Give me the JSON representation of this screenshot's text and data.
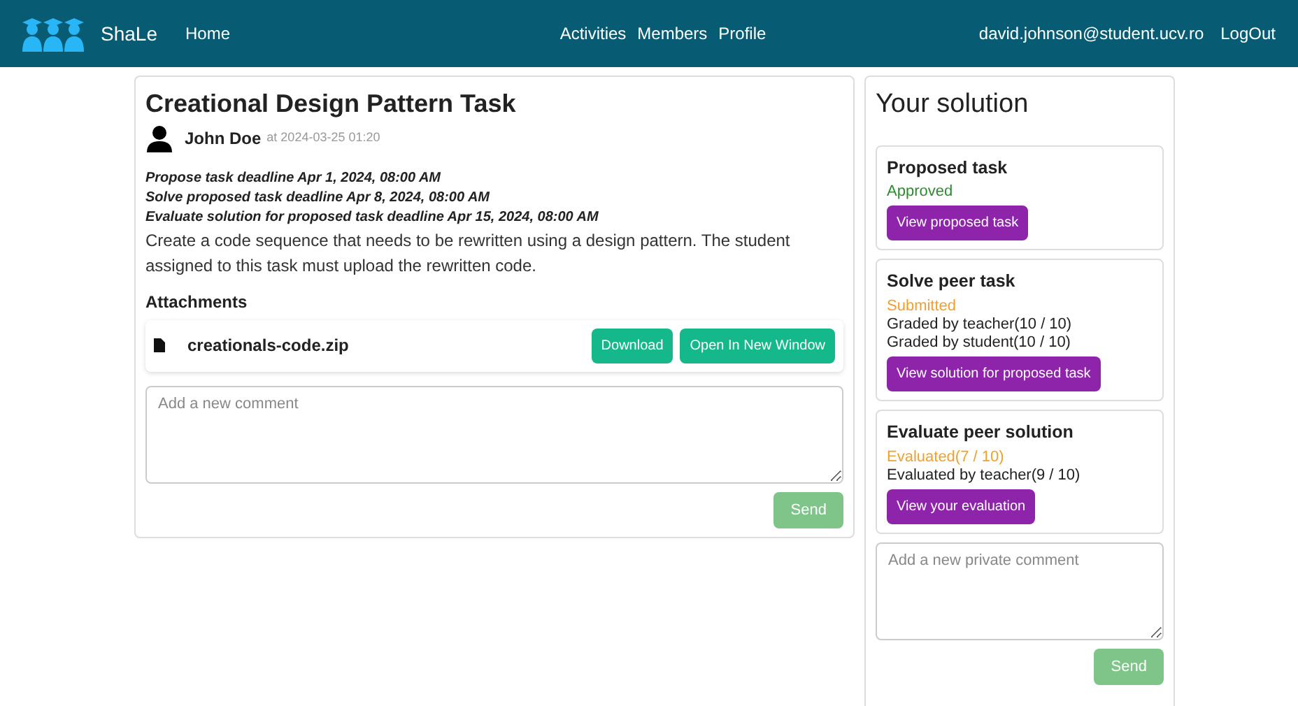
{
  "navbar": {
    "brand": "ShaLe",
    "left_links": [
      "Home"
    ],
    "center_links": [
      "Activities",
      "Members",
      "Profile"
    ],
    "user": "david.johnson@student.ucv.ro",
    "logout": "LogOut"
  },
  "task": {
    "title": "Creational Design Pattern Task",
    "author": "John Doe",
    "posted": "at 2024-03-25 01:20",
    "deadlines": [
      "Propose task deadline Apr 1, 2024, 08:00 AM",
      "Solve proposed task deadline Apr 8, 2024, 08:00 AM",
      "Evaluate solution for proposed task deadline Apr 15, 2024, 08:00 AM"
    ],
    "description": "Create a code sequence that needs to be rewritten using a design pattern. The student assigned to this task must upload the rewritten code.",
    "attachments_title": "Attachments",
    "attachments": [
      {
        "name": "creationals-code.zip",
        "actions": [
          "Download",
          "Open In New Window"
        ]
      }
    ],
    "comment": {
      "placeholder": "Add a new comment",
      "send": "Send",
      "disabled": true
    }
  },
  "solution": {
    "title": "Your solution",
    "steps": [
      {
        "title": "Proposed task",
        "status": "Approved",
        "color": "#2e8b2e",
        "button": "View proposed task"
      },
      {
        "title": "Solve peer task",
        "status": "Submitted",
        "color": "#f0a030",
        "lines": [
          "Graded by teacher(10 / 10)",
          "Graded by student(10 / 10)"
        ],
        "button": "View solution for proposed task"
      },
      {
        "title": "Evaluate peer solution",
        "status": "Evaluated(7 / 10)",
        "color": "#f0a030",
        "lines": [
          "Evaluated by teacher(9 / 10)"
        ],
        "button": "View your evaluation"
      }
    ],
    "comment": {
      "placeholder": "Add a new private comment",
      "send": "Send",
      "disabled": true
    }
  }
}
